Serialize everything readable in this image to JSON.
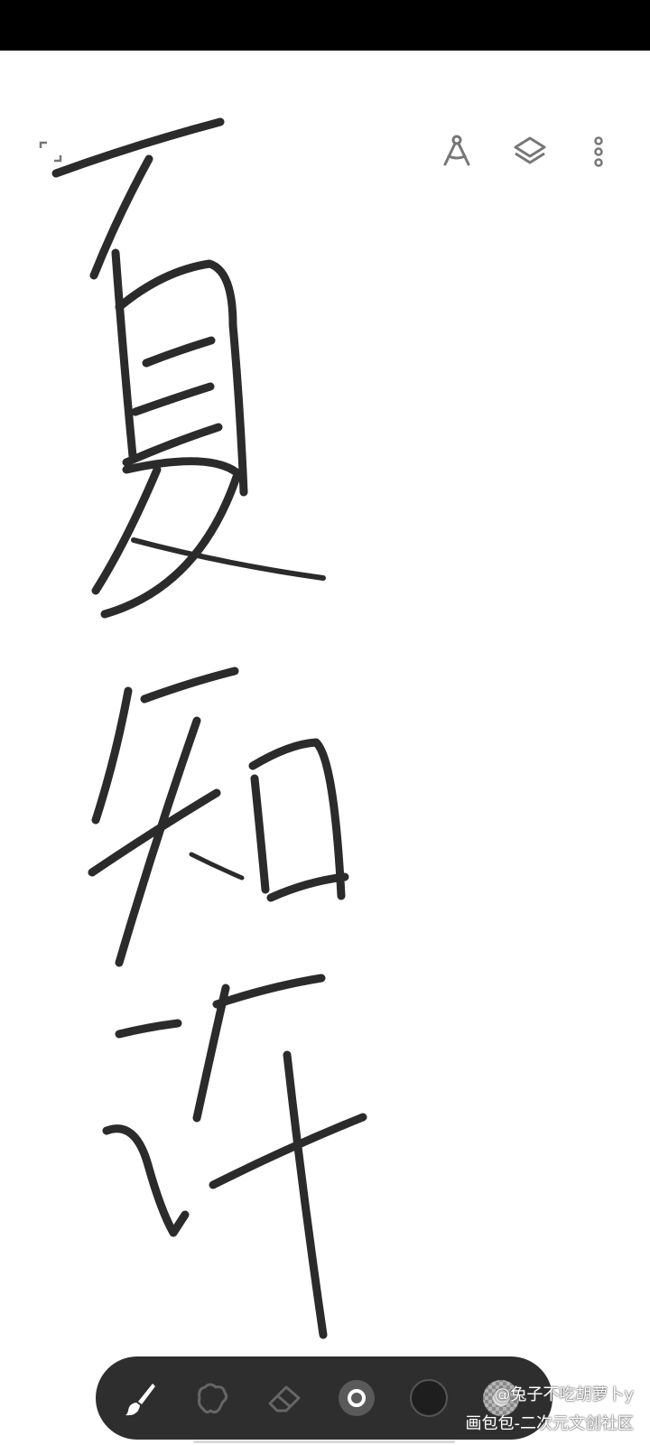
{
  "status_bar": {
    "color": "#000000"
  },
  "canvas": {
    "background": "#ffffff",
    "ink_color": "#2b2b2b",
    "drawn_text": [
      "夏",
      "知",
      "许"
    ]
  },
  "top_bar": {
    "icons": [
      "fullscreen-icon",
      "ruler-icon",
      "layers-icon",
      "more-vertical-icon"
    ]
  },
  "toolbar": {
    "tools": [
      "brush-icon",
      "smudge-icon",
      "eraser-icon",
      "brush-size-icon",
      "color-swatch",
      "opacity-icon"
    ],
    "selected_tool": "brush",
    "current_color": "#1e1e1e",
    "background": "#2e2e2e"
  },
  "watermark": {
    "user": "@兔子不吃胡萝卜y",
    "site": "画包包-二次元文创社区"
  }
}
